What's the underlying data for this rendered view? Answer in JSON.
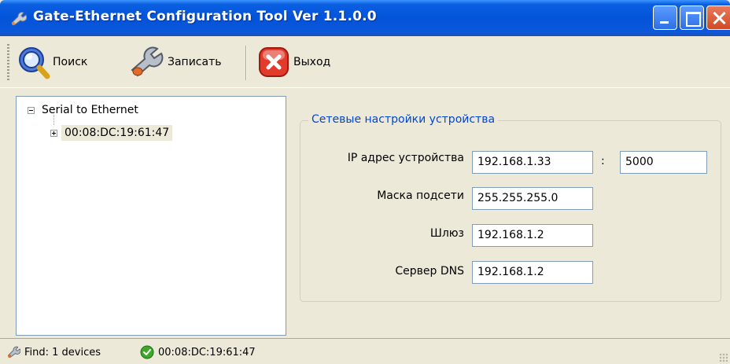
{
  "window": {
    "title": "Gate-Ethernet Configuration Tool Ver 1.1.0.0",
    "icon": "wrench-icon"
  },
  "toolbar": {
    "search_label": "Поиск",
    "write_label": "Записать",
    "exit_label": "Выход"
  },
  "tree": {
    "root_label": "Serial to Ethernet",
    "device_label": "00:08:DC:19:61:47"
  },
  "network": {
    "group_title": "Сетевые настройки устройства",
    "ip_label": "IP адрес устройства",
    "ip_value": "192.168.1.33",
    "port_separator": ":",
    "port_value": "5000",
    "mask_label": "Маска подсети",
    "mask_value": "255.255.255.0",
    "gateway_label": "Шлюз",
    "gateway_value": "192.168.1.2",
    "dns_label": "Сервер DNS",
    "dns_value": "192.168.1.2"
  },
  "status": {
    "find_text": "Find: 1 devices",
    "device_text": "00:08:DC:19:61:47"
  },
  "colors": {
    "titlebar": "#0353D9",
    "group_title": "#0046D5",
    "close_button": "#D14A24",
    "ok_green": "#3FA82B"
  }
}
